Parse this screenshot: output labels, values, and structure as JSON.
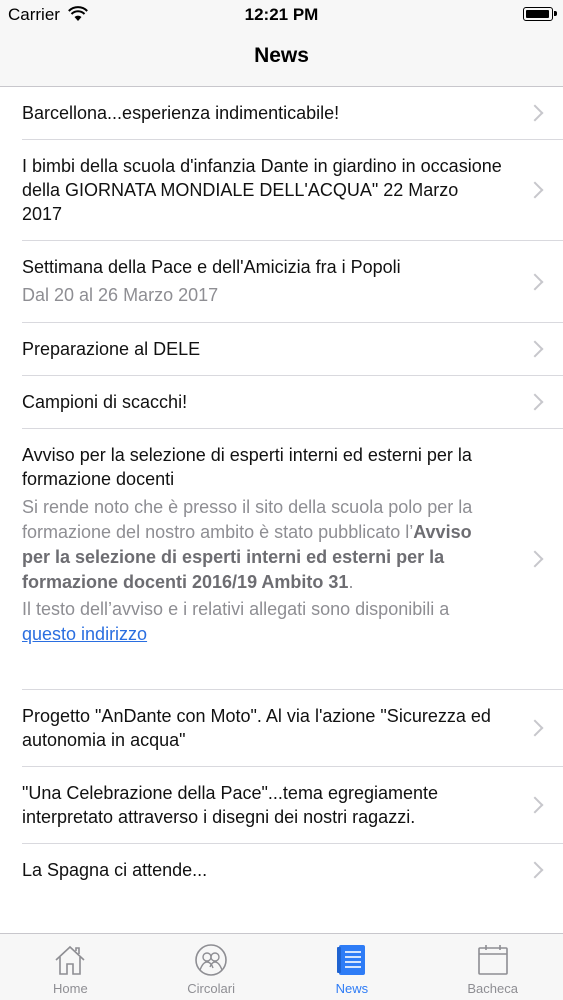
{
  "status_bar": {
    "carrier": "Carrier",
    "time": "12:21 PM"
  },
  "nav": {
    "title": "News"
  },
  "news": [
    {
      "title": "Barcellona...esperienza indimenticabile!"
    },
    {
      "title": "I bimbi della scuola d'infanzia Dante in giardino in occasione della GIORNATA MONDIALE DELL'ACQUA\" 22 Marzo 2017"
    },
    {
      "title": "Settimana della Pace e dell'Amicizia fra i Popoli",
      "subtitle": "Dal 20 al 26 Marzo 2017"
    },
    {
      "title": "Preparazione al DELE"
    },
    {
      "title": "Campioni di scacchi!"
    },
    {
      "title": "Avviso per la selezione di esperti interni ed esterni per la formazione docenti",
      "body_intro": "Si rende noto che è presso il sito della scuola polo per la formazione del nostro ambito è stato pubblicato l’",
      "body_bold": "Avviso per la selezione di esperti interni ed esterni per la formazione docenti 2016/19 Ambito 31",
      "body_after": ".",
      "body_more": "Il testo dell’avviso e i relativi allegati sono disponibili a",
      "link_text": "questo indirizzo"
    },
    {
      "title": "Progetto \"AnDante con Moto\". Al via l'azione \"Sicurezza ed autonomia in acqua\""
    },
    {
      "title": "\"Una Celebrazione della Pace\"...tema egregiamente interpretato attraverso i disegni dei nostri ragazzi."
    },
    {
      "title": "La Spagna ci attende..."
    }
  ],
  "tabs": [
    {
      "label": "Home",
      "icon": "home-icon"
    },
    {
      "label": "Circolari",
      "icon": "users-icon"
    },
    {
      "label": "News",
      "icon": "news-icon",
      "active": true
    },
    {
      "label": "Bacheca",
      "icon": "calendar-icon"
    }
  ],
  "colors": {
    "accent": "#2e7cf6",
    "inactive": "#8e8e93",
    "bar_bg": "#f7f7f7",
    "link": "#2a6ee0"
  }
}
